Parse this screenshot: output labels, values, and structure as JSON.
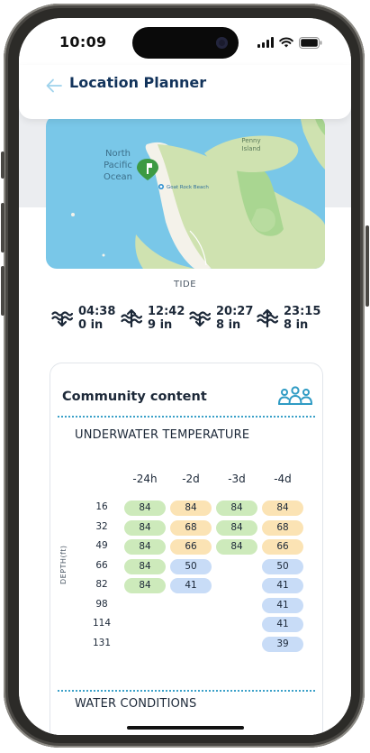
{
  "status": {
    "time": "10:09"
  },
  "header": {
    "title": "Location Planner"
  },
  "map": {
    "ocean_label_1": "North",
    "ocean_label_2": "Pacific",
    "ocean_label_3": "Ocean",
    "island_label_1": "Penny",
    "island_label_2": "Island",
    "beach_label": "Goat Rock Beach"
  },
  "tide": {
    "label": "TIDE",
    "items": [
      {
        "time": "04:38",
        "height": "0 in",
        "direction": "low-tide-icon"
      },
      {
        "time": "12:42",
        "height": "9 in",
        "direction": "high-tide-icon"
      },
      {
        "time": "20:27",
        "height": "8 in",
        "direction": "low-tide-icon"
      },
      {
        "time": "23:15",
        "height": "8 in",
        "direction": "high-tide-icon"
      }
    ]
  },
  "community": {
    "title": "Community content",
    "icon": "people-group-icon",
    "temperature": {
      "title": "UNDERWATER TEMPERATURE",
      "axis_label": "DEPTH(ft)",
      "columns": [
        "-24h",
        "-2d",
        "-3d",
        "-4d"
      ],
      "depths": [
        "16",
        "32",
        "49",
        "66",
        "82",
        "98",
        "114",
        "131"
      ],
      "cells": [
        [
          "84",
          "84",
          "84",
          "84"
        ],
        [
          "84",
          "68",
          "84",
          "68"
        ],
        [
          "84",
          "66",
          "84",
          "66"
        ],
        [
          "84",
          "50",
          "",
          "50"
        ],
        [
          "84",
          "41",
          "",
          "41"
        ],
        [
          "",
          "",
          "",
          "41"
        ],
        [
          "",
          "",
          "",
          "41"
        ],
        [
          "",
          "",
          "",
          "39"
        ]
      ],
      "colors": [
        [
          "green",
          "orange",
          "green",
          "orange"
        ],
        [
          "green",
          "orange",
          "green",
          "orange"
        ],
        [
          "green",
          "orange",
          "green",
          "orange"
        ],
        [
          "green",
          "blue",
          "",
          "blue"
        ],
        [
          "green",
          "blue",
          "",
          "blue"
        ],
        [
          "",
          "",
          "",
          "blue"
        ],
        [
          "",
          "",
          "",
          "blue"
        ],
        [
          "",
          "",
          "",
          "blue"
        ]
      ]
    },
    "water_conditions": {
      "title": "WATER CONDITIONS"
    }
  },
  "colors": {
    "accent": "#3aa0c8",
    "title": "#12335b",
    "green": "#cdeabb",
    "orange": "#fbe3b4",
    "blue": "#c8dcf7"
  }
}
